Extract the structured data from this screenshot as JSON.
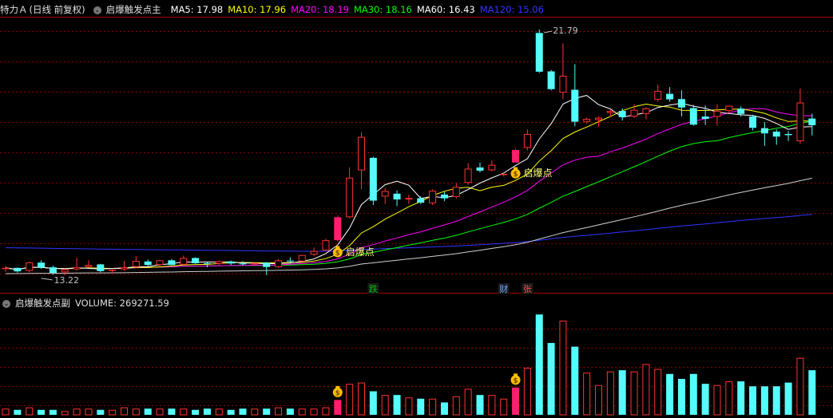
{
  "header_main": {
    "stock_name": "特力Ａ",
    "period": "(日线 前复权)",
    "indicator": "启爆触发点主",
    "ma": [
      {
        "label": "MA5: 17.98",
        "color": "#ffffff"
      },
      {
        "label": "MA10: 17.96",
        "color": "#ffff00"
      },
      {
        "label": "MA20: 18.19",
        "color": "#ff00ff"
      },
      {
        "label": "MA30: 18.16",
        "color": "#00ff00"
      },
      {
        "label": "MA60: 16.43",
        "color": "#ffffff"
      },
      {
        "label": "MA120: 15.06",
        "color": "#3333ff"
      }
    ]
  },
  "header_sub": {
    "indicator": "启爆触发点副",
    "volume_label": "VOLUME: 269271.59"
  },
  "colors": {
    "up": "#ff3232",
    "down": "#54fcfc",
    "signal": "#ff1e6e",
    "grid": "#8b0000",
    "gold": "#ffc000"
  },
  "chart_data": {
    "type": "candlestick",
    "high_label": "21.79",
    "low_label": "13.22",
    "signal_label": "启爆点",
    "markers": [
      {
        "index": 31,
        "text": "跌",
        "color": "#00c000"
      },
      {
        "index": 42,
        "text": "财",
        "color": "#6aa8ff"
      },
      {
        "index": 44,
        "text": "张",
        "color": "#ff5050"
      }
    ],
    "signals": [
      28,
      43
    ],
    "ohlc": [
      [
        13.56,
        13.66,
        13.46,
        13.6
      ],
      [
        13.6,
        13.62,
        13.44,
        13.48
      ],
      [
        13.5,
        13.82,
        13.45,
        13.79
      ],
      [
        13.78,
        13.86,
        13.57,
        13.61
      ],
      [
        13.62,
        13.68,
        13.36,
        13.43
      ],
      [
        13.45,
        13.58,
        13.35,
        13.55
      ],
      [
        13.55,
        13.95,
        13.5,
        13.63
      ],
      [
        13.63,
        13.86,
        13.6,
        13.7
      ],
      [
        13.72,
        13.74,
        13.45,
        13.49
      ],
      [
        13.5,
        13.58,
        13.42,
        13.54
      ],
      [
        13.55,
        13.84,
        13.5,
        13.62
      ],
      [
        13.63,
        14.0,
        13.6,
        13.84
      ],
      [
        13.82,
        13.89,
        13.66,
        13.7
      ],
      [
        13.7,
        13.88,
        13.63,
        13.86
      ],
      [
        13.86,
        13.9,
        13.69,
        13.7
      ],
      [
        13.71,
        14.02,
        13.7,
        13.94
      ],
      [
        13.94,
        13.96,
        13.74,
        13.76
      ],
      [
        13.76,
        13.8,
        13.62,
        13.75
      ],
      [
        13.74,
        13.85,
        13.7,
        13.83
      ],
      [
        13.82,
        13.85,
        13.7,
        13.75
      ],
      [
        13.75,
        13.83,
        13.68,
        13.74
      ],
      [
        13.72,
        13.78,
        13.66,
        13.77
      ],
      [
        13.78,
        13.8,
        13.35,
        13.63
      ],
      [
        13.63,
        13.9,
        13.6,
        13.86
      ],
      [
        13.85,
        13.96,
        13.8,
        13.82
      ],
      [
        13.82,
        14.05,
        13.8,
        14.04
      ],
      [
        14.06,
        14.3,
        14.0,
        14.18
      ],
      [
        14.2,
        14.6,
        14.18,
        14.55
      ],
      [
        14.55,
        15.4,
        14.5,
        15.34
      ],
      [
        15.34,
        17.05,
        15.3,
        16.7
      ],
      [
        16.95,
        18.25,
        16.3,
        18.1
      ],
      [
        17.38,
        17.42,
        15.76,
        15.91
      ],
      [
        16.05,
        16.35,
        15.79,
        16.24
      ],
      [
        16.15,
        16.26,
        15.72,
        15.95
      ],
      [
        15.95,
        16.12,
        15.8,
        16.0
      ],
      [
        15.99,
        16.06,
        15.79,
        15.84
      ],
      [
        15.82,
        16.3,
        15.76,
        16.25
      ],
      [
        16.12,
        16.22,
        15.89,
        15.99
      ],
      [
        16.04,
        16.52,
        15.99,
        16.38
      ],
      [
        16.52,
        17.2,
        16.46,
        17.01
      ],
      [
        17.05,
        17.21,
        16.88,
        16.94
      ],
      [
        16.95,
        17.29,
        16.92,
        17.14
      ],
      [
        16.8,
        16.89,
        16.74,
        16.83
      ],
      [
        17.22,
        17.7,
        17.21,
        17.65
      ],
      [
        17.72,
        18.36,
        17.64,
        18.2
      ],
      [
        21.67,
        21.79,
        20.3,
        20.34
      ],
      [
        20.35,
        20.4,
        19.7,
        19.74
      ],
      [
        19.62,
        21.32,
        19.4,
        20.2
      ],
      [
        19.72,
        20.6,
        18.46,
        18.62
      ],
      [
        18.62,
        18.77,
        18.56,
        18.72
      ],
      [
        18.68,
        18.8,
        18.46,
        18.76
      ],
      [
        18.92,
        19.05,
        18.8,
        18.99
      ],
      [
        18.99,
        19.08,
        18.66,
        18.78
      ],
      [
        18.8,
        19.23,
        18.75,
        19.03
      ],
      [
        18.89,
        19.12,
        18.7,
        19.08
      ],
      [
        19.38,
        19.89,
        19.31,
        19.68
      ],
      [
        19.58,
        19.81,
        19.31,
        19.39
      ],
      [
        19.4,
        19.7,
        18.8,
        19.11
      ],
      [
        19.09,
        19.2,
        18.48,
        18.52
      ],
      [
        18.8,
        19.18,
        18.51,
        18.72
      ],
      [
        18.79,
        19.23,
        18.49,
        18.99
      ],
      [
        18.99,
        19.18,
        18.92,
        19.17
      ],
      [
        19.07,
        19.15,
        18.8,
        18.89
      ],
      [
        18.8,
        18.86,
        18.32,
        18.41
      ],
      [
        18.4,
        18.61,
        17.79,
        18.22
      ],
      [
        18.28,
        18.36,
        17.83,
        18.11
      ],
      [
        18.2,
        18.3,
        17.96,
        18.16
      ],
      [
        17.95,
        19.77,
        17.86,
        19.28
      ],
      [
        18.73,
        18.9,
        18.15,
        18.5
      ]
    ],
    "volume": [
      5,
      4,
      6,
      4,
      4,
      3,
      5,
      5,
      4,
      4,
      6,
      5,
      5,
      5,
      5,
      5,
      4,
      5,
      5,
      4,
      5,
      5,
      5,
      6,
      5,
      5,
      5,
      6,
      12,
      25,
      26,
      19,
      16,
      16,
      14,
      13,
      13,
      10,
      15,
      21,
      16,
      16,
      13,
      22,
      38,
      81,
      58,
      76,
      55,
      34,
      24,
      35,
      36,
      35,
      41,
      37,
      33,
      29,
      33,
      25,
      24,
      27,
      27,
      23,
      23,
      23,
      26,
      46,
      36
    ],
    "volume_ylim": [
      0,
      85
    ],
    "ylim": [
      12.8,
      22.2
    ]
  }
}
